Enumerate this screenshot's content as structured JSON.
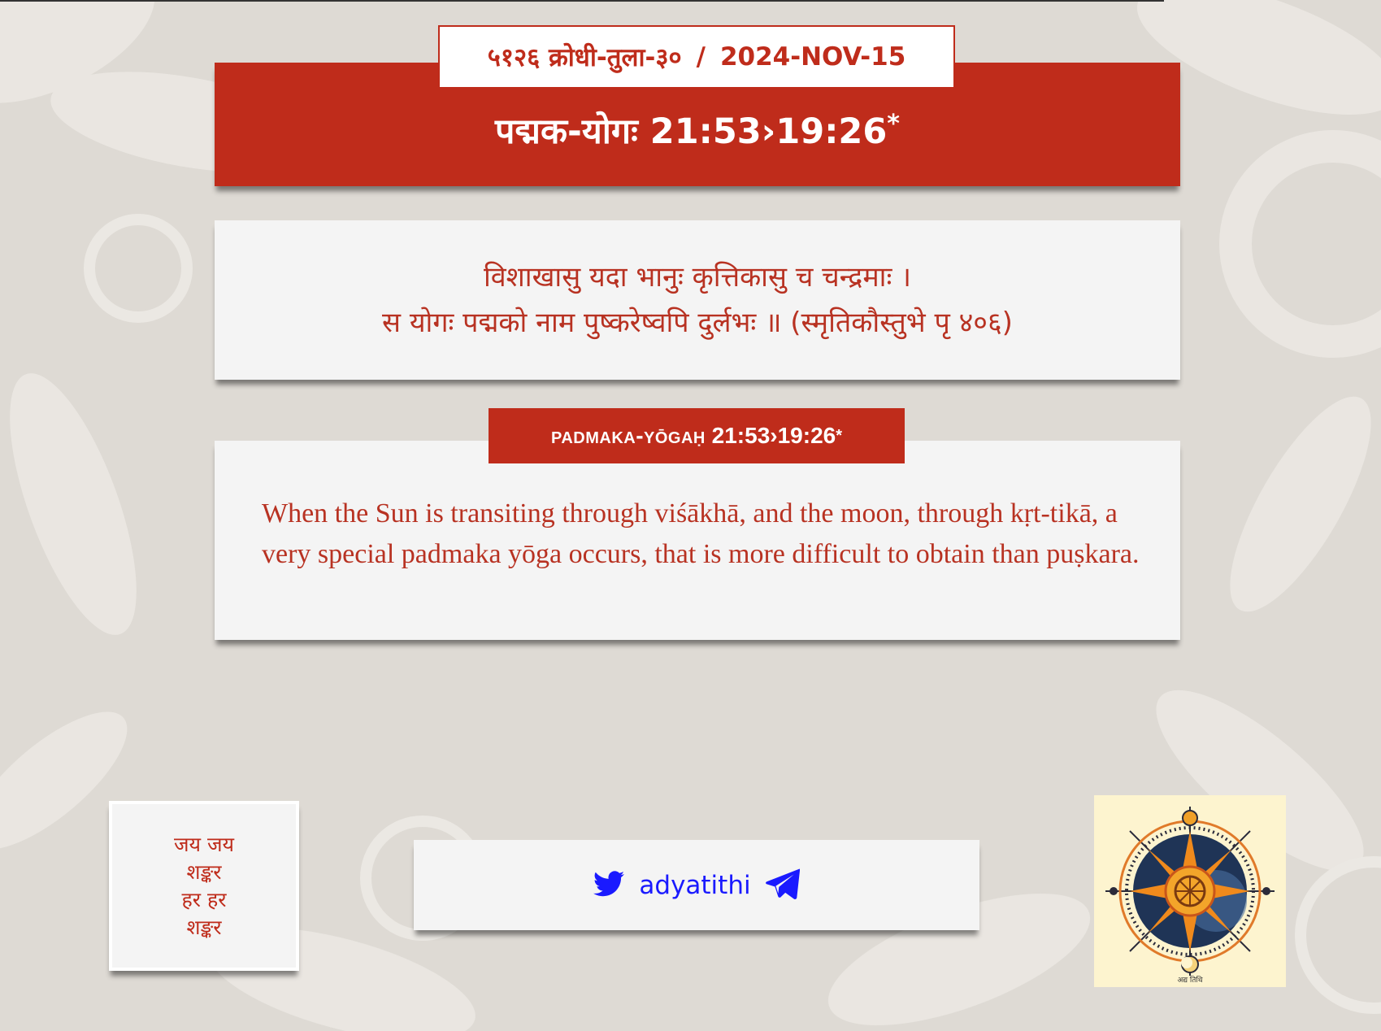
{
  "header": {
    "date_label": "५१२६ क्रोधी-तुला-३०",
    "date_separator": "/",
    "gregorian_date": "2024-NOV-15",
    "title": "पद्मक-योगः 21:53›19:26",
    "title_marker": "*"
  },
  "verse": {
    "line1": "विशाखासु यदा भानुः कृत्तिकासु च चन्द्रमाः ।",
    "line2": "स योगः पद्मको नाम पुष्करेष्वपि दुर्लभः ॥ (स्मृतिकौस्तुभे पृ ४०६)"
  },
  "translation": {
    "badge_name": "Padmaka-yōgaḥ",
    "badge_time": "21:53›19:26",
    "badge_marker": "*",
    "text": "When the Sun is transiting through viśākhā, and the moon, through kṛt-tikā, a very special padmaka yōga occurs, that is more difficult to obtain than puṣkara."
  },
  "footer": {
    "shiva_lines": [
      "जय जय",
      "शङ्कर",
      "हर हर",
      "शङ्कर"
    ],
    "social_handle": "adyatithi",
    "social_icons": [
      "twitter-icon",
      "telegram-icon"
    ],
    "logo_caption": "अद्य तिथि"
  },
  "colors": {
    "accent": "#bf2c1b",
    "background": "#dedad4",
    "card": "#f4f4f4",
    "link": "#1a1aff"
  }
}
